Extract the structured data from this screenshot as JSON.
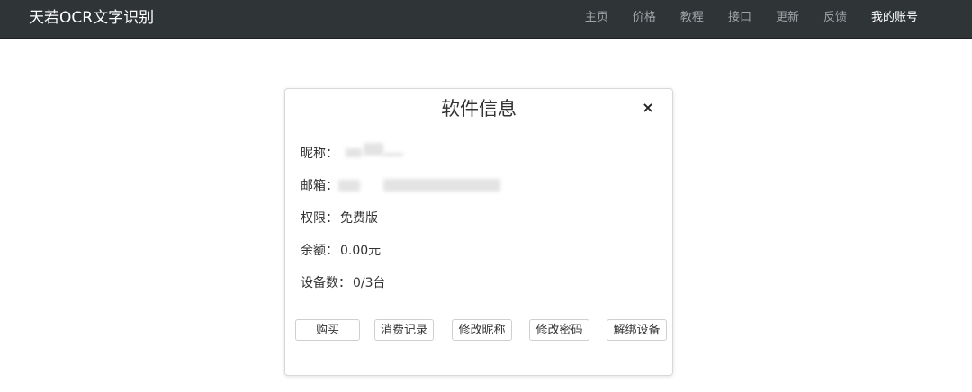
{
  "navbar": {
    "brand": "天若OCR文字识别",
    "links": [
      {
        "label": "主页"
      },
      {
        "label": "价格"
      },
      {
        "label": "教程"
      },
      {
        "label": "接口"
      },
      {
        "label": "更新"
      },
      {
        "label": "反馈"
      },
      {
        "label": "我的账号"
      }
    ]
  },
  "modal": {
    "title": "软件信息",
    "close_symbol": "×",
    "fields": {
      "nickname_label": "昵称：",
      "email_label": "邮箱：",
      "permission_label": "权限：",
      "permission_value": "免费版",
      "balance_label": "余额：",
      "balance_value": "0.00元",
      "devices_label": "设备数：",
      "devices_value": "0/3台"
    },
    "buttons": {
      "buy": "购买",
      "history": "消费记录",
      "edit_nickname": "修改昵称",
      "edit_password": "修改密码",
      "unbind_device": "解绑设备"
    }
  },
  "colors": {
    "navbar_bg": "#2f3437",
    "nav_text": "#9da3a6",
    "nav_active": "#ffffff"
  }
}
